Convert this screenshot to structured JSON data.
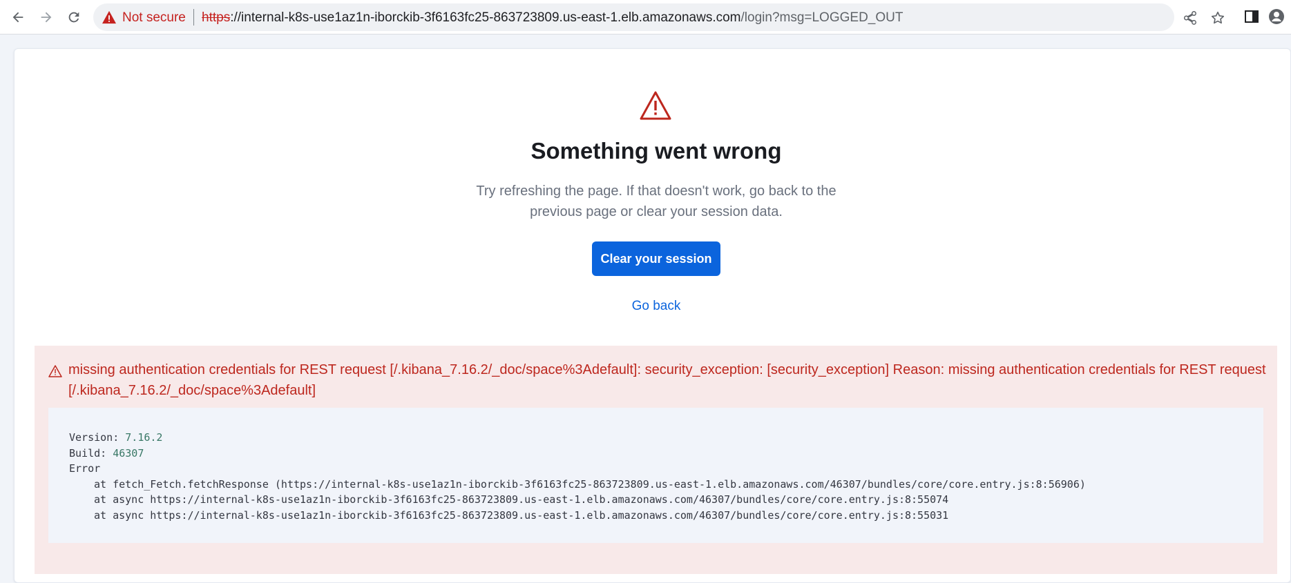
{
  "browser": {
    "security_label": "Not secure",
    "url_scheme": "https",
    "url_host": "://internal-k8s-use1az1n-iborckib-3f6163fc25-863723809.us-east-1.elb.amazonaws.com",
    "url_path": "/login?msg=LOGGED_OUT",
    "icons": [
      "back-arrow-icon",
      "forward-arrow-icon",
      "reload-icon",
      "warning-icon",
      "share-icon",
      "star-icon",
      "side-panel-icon",
      "profile-icon"
    ]
  },
  "error_page": {
    "title": "Something went wrong",
    "description": "Try refreshing the page. If that doesn't work, go back to the previous page or clear your session data.",
    "clear_button": "Clear your session",
    "go_back": "Go back"
  },
  "callout": {
    "title": "missing authentication credentials for REST request [/.kibana_7.16.2/_doc/space%3Adefault]: security_exception: [security_exception] Reason: missing authentication credentials for REST request [/.kibana_7.16.2/_doc/space%3Adefault]",
    "version_label": "Version: ",
    "version_value": "7.16.2",
    "build_label": "Build: ",
    "build_value": "46307",
    "error_label": "Error",
    "stack": [
      "at fetch_Fetch.fetchResponse (https://internal-k8s-use1az1n-iborckib-3f6163fc25-863723809.us-east-1.elb.amazonaws.com/46307/bundles/core/core.entry.js:8:56906)",
      "at async https://internal-k8s-use1az1n-iborckib-3f6163fc25-863723809.us-east-1.elb.amazonaws.com/46307/bundles/core/core.entry.js:8:55074",
      "at async https://internal-k8s-use1az1n-iborckib-3f6163fc25-863723809.us-east-1.elb.amazonaws.com/46307/bundles/core/core.entry.js:8:55031"
    ]
  },
  "colors": {
    "danger": "#bd271e",
    "primary": "#0b64dd",
    "callout_bg": "#f8e9e9"
  }
}
